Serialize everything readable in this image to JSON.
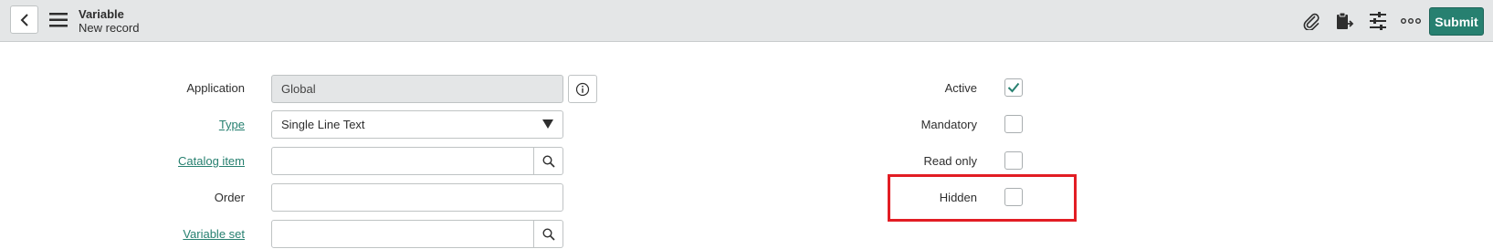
{
  "header": {
    "title": "Variable",
    "subtitle": "New record",
    "submit_label": "Submit",
    "icons": [
      "back-icon",
      "menu-icon",
      "paperclip-icon",
      "clipboard-icon",
      "sliders-icon",
      "more-icon"
    ]
  },
  "form": {
    "application": {
      "label": "Application",
      "value": "Global"
    },
    "type": {
      "label": "Type",
      "value": "Single Line Text"
    },
    "catalog_item": {
      "label": "Catalog item",
      "value": ""
    },
    "order": {
      "label": "Order",
      "value": ""
    },
    "variable_set": {
      "label": "Variable set",
      "value": ""
    },
    "active": {
      "label": "Active",
      "checked": true
    },
    "mandatory": {
      "label": "Mandatory",
      "checked": false
    },
    "read_only": {
      "label": "Read only",
      "checked": false
    },
    "hidden": {
      "label": "Hidden",
      "checked": false
    }
  },
  "colors": {
    "accent": "#278070",
    "header_bg": "#e4e6e7",
    "highlight": "#e21d24"
  }
}
